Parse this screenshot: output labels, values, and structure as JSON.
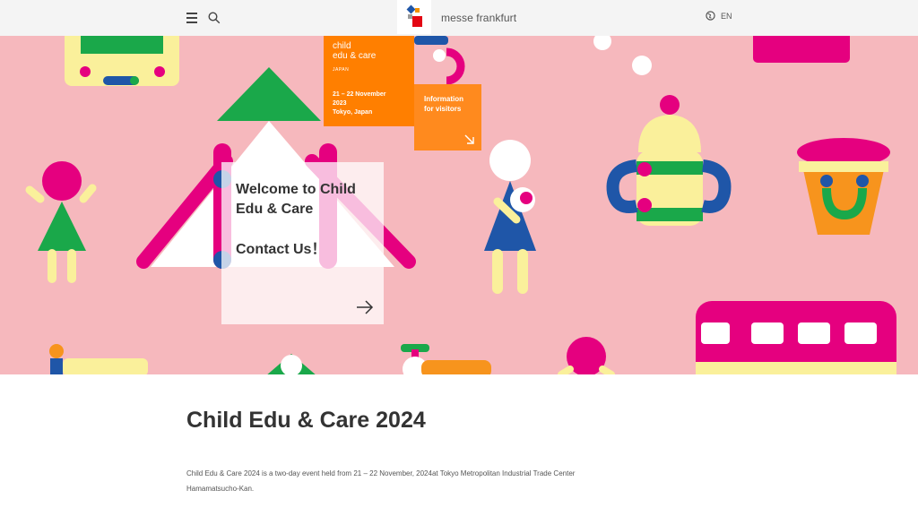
{
  "header": {
    "brand": "messe frankfurt",
    "lang": "EN",
    "icons": {
      "menu": "menu-icon",
      "search": "search-icon",
      "globe": "globe-icon",
      "logo": "messe-frankfurt-logo"
    }
  },
  "hero": {
    "badge": {
      "name_line1": "child",
      "name_line2": "edu & care",
      "sub": "JAPAN",
      "date_line1": "21 – 22 November",
      "date_line2": "2023",
      "location": "Tokyo, Japan"
    },
    "info": {
      "line1": "Information",
      "line2": "for visitors",
      "arrow_icon": "arrow-down-right-icon"
    },
    "welcome": {
      "line1": "Welcome to Child",
      "line2": "Edu & Care",
      "contact": "Contact Us！",
      "arrow_icon": "arrow-right-icon"
    },
    "colors": {
      "bg": "#f6b8bd",
      "orange": "#ff7f00",
      "magenta": "#e5007f",
      "green": "#1aa84a",
      "blue": "#1f56a8",
      "yellow": "#faf09b"
    }
  },
  "content": {
    "title": "Child Edu & Care 2024",
    "text": "Child Edu & Care 2024 is a two-day event held from 21 – 22 November, 2024at Tokyo Metropolitan Industrial Trade Center Hamamatsucho-Kan."
  }
}
